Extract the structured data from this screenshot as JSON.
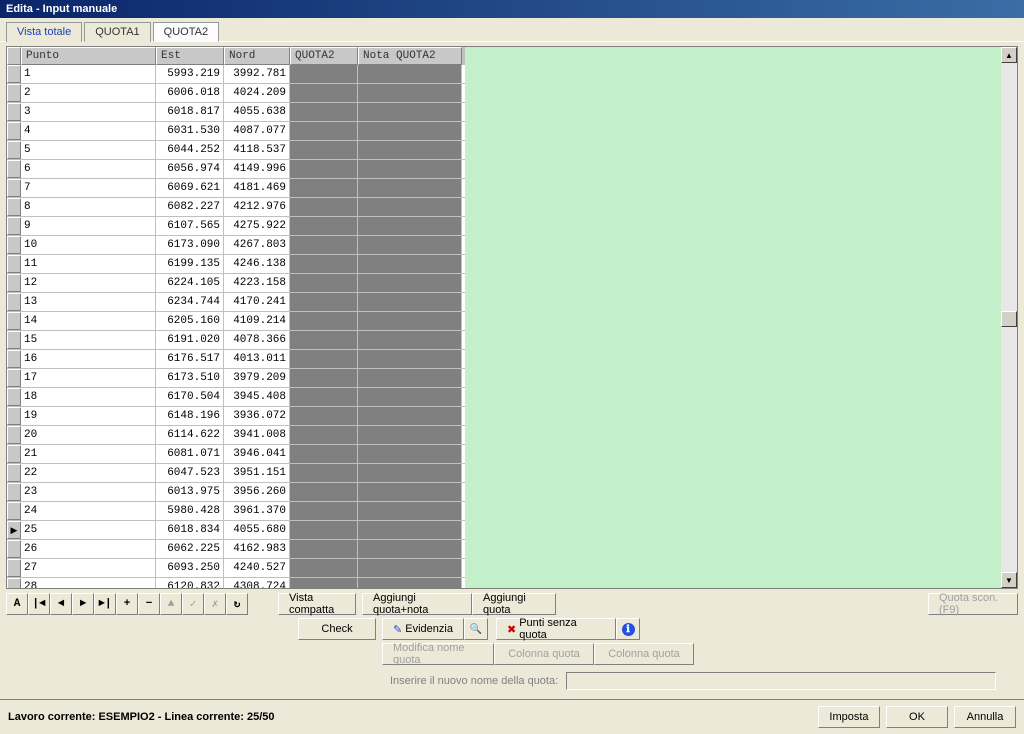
{
  "title": "Edita - Input manuale",
  "tabs": [
    {
      "label": "Vista totale",
      "active": false,
      "link": true
    },
    {
      "label": "QUOTA1",
      "active": false,
      "link": false
    },
    {
      "label": "QUOTA2",
      "active": true,
      "link": false
    }
  ],
  "columns": {
    "indicator": "",
    "punto": "Punto",
    "est": "Est",
    "nord": "Nord",
    "quota2": "QUOTA2",
    "nota": "Nota QUOTA2"
  },
  "rows": [
    {
      "punto": "1",
      "est": "5993.219",
      "nord": "3992.781"
    },
    {
      "punto": "2",
      "est": "6006.018",
      "nord": "4024.209"
    },
    {
      "punto": "3",
      "est": "6018.817",
      "nord": "4055.638"
    },
    {
      "punto": "4",
      "est": "6031.530",
      "nord": "4087.077"
    },
    {
      "punto": "5",
      "est": "6044.252",
      "nord": "4118.537"
    },
    {
      "punto": "6",
      "est": "6056.974",
      "nord": "4149.996"
    },
    {
      "punto": "7",
      "est": "6069.621",
      "nord": "4181.469"
    },
    {
      "punto": "8",
      "est": "6082.227",
      "nord": "4212.976"
    },
    {
      "punto": "9",
      "est": "6107.565",
      "nord": "4275.922"
    },
    {
      "punto": "10",
      "est": "6173.090",
      "nord": "4267.803"
    },
    {
      "punto": "11",
      "est": "6199.135",
      "nord": "4246.138"
    },
    {
      "punto": "12",
      "est": "6224.105",
      "nord": "4223.158"
    },
    {
      "punto": "13",
      "est": "6234.744",
      "nord": "4170.241"
    },
    {
      "punto": "14",
      "est": "6205.160",
      "nord": "4109.214"
    },
    {
      "punto": "15",
      "est": "6191.020",
      "nord": "4078.366"
    },
    {
      "punto": "16",
      "est": "6176.517",
      "nord": "4013.011"
    },
    {
      "punto": "17",
      "est": "6173.510",
      "nord": "3979.209"
    },
    {
      "punto": "18",
      "est": "6170.504",
      "nord": "3945.408"
    },
    {
      "punto": "19",
      "est": "6148.196",
      "nord": "3936.072"
    },
    {
      "punto": "20",
      "est": "6114.622",
      "nord": "3941.008"
    },
    {
      "punto": "21",
      "est": "6081.071",
      "nord": "3946.041"
    },
    {
      "punto": "22",
      "est": "6047.523",
      "nord": "3951.151"
    },
    {
      "punto": "23",
      "est": "6013.975",
      "nord": "3956.260"
    },
    {
      "punto": "24",
      "est": "5980.428",
      "nord": "3961.370"
    },
    {
      "punto": "25",
      "est": "6018.834",
      "nord": "4055.680",
      "current": true
    },
    {
      "punto": "26",
      "est": "6062.225",
      "nord": "4162.983"
    },
    {
      "punto": "27",
      "est": "6093.250",
      "nord": "4240.527"
    },
    {
      "punto": "28",
      "est": "6120.832",
      "nord": "4308.724"
    }
  ],
  "nav_buttons": [
    "A",
    "|◄",
    "◄",
    "►",
    "►|",
    "+",
    "−",
    "▲",
    "✓",
    "✗",
    "↻"
  ],
  "buttons": {
    "vista_compatta": "Vista compatta",
    "check": "Check",
    "aggiungi_quota_nota": "Aggiungi quota+nota",
    "aggiungi_quota": "Aggiungi quota",
    "quota_scon": "Quota scon. (F9)",
    "evidenzia": "Evidenzia",
    "punti_senza_quota": "Punti senza quota",
    "modifica_nome_quota": "Modifica nome quota",
    "colonna_quota_1": "Colonna quota",
    "colonna_quota_2": "Colonna quota"
  },
  "label_inserire": "Inserire il nuovo nome della quota:",
  "status": "Lavoro corrente: ESEMPIO2 - Linea corrente: 25/50",
  "footer_buttons": {
    "imposta": "Imposta",
    "ok": "OK",
    "annulla": "Annulla"
  }
}
